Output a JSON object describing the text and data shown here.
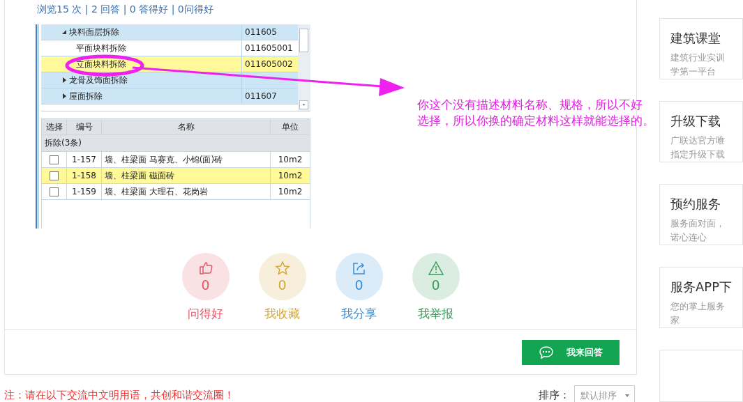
{
  "stats": "浏览15 次 | 2 回答 | 0 答得好 | 0问得好",
  "embedded_screenshot": {
    "tree": [
      {
        "label": "块料面层拆除",
        "code": "011605",
        "expanded": true,
        "selected": false,
        "children": [
          {
            "label": "平面块料拆除",
            "code": "011605001",
            "selected": false
          },
          {
            "label": "立面块料拆除",
            "code": "011605002",
            "selected": true
          }
        ]
      },
      {
        "label": "龙骨及饰面拆除",
        "expanded": false,
        "selected": false
      },
      {
        "label": "屋面拆除",
        "code": "011607",
        "expanded": false,
        "selected": false
      }
    ],
    "table": {
      "columns": [
        "选择",
        "编号",
        "名称",
        "单位"
      ],
      "group": "拆除(3条)",
      "rows": [
        {
          "checked": false,
          "selected": false,
          "code": "1-157",
          "name": "墙、柱梁面 马赛克、小锦(面)砖",
          "unit": "10m2"
        },
        {
          "checked": false,
          "selected": true,
          "code": "1-158",
          "name": "墙、柱梁面 磁面砖",
          "unit": "10m2"
        },
        {
          "checked": false,
          "selected": false,
          "code": "1-159",
          "name": "墙、柱梁面 大理石、花岗岩",
          "unit": "10m2"
        }
      ]
    }
  },
  "annotation": {
    "lines": [
      "你这个没有描述材料名称、规格，所以不好",
      "选择，所以你换的确定材料这样就能选择的。"
    ]
  },
  "actions": [
    {
      "kind": "like",
      "count": "0",
      "label": "问得好",
      "color": "#e05a6a"
    },
    {
      "kind": "favorite",
      "count": "0",
      "label": "我收藏",
      "color": "#d4a83a"
    },
    {
      "kind": "share",
      "count": "0",
      "label": "我分享",
      "color": "#3a8fd8"
    },
    {
      "kind": "report",
      "count": "0",
      "label": "我举报",
      "color": "#3a9a5a"
    }
  ],
  "answer_button": "我来回答",
  "notice": "注：请在以下交流中文明用语，共创和谐交流圈！",
  "sort": {
    "label": "排序：",
    "value": "默认排序"
  },
  "sidebar": [
    {
      "title": "建筑课堂",
      "lines": [
        "建筑行业实训",
        "学第一平台"
      ]
    },
    {
      "title": "升级下载",
      "lines": [
        "广联达官方唯",
        "指定升级下载"
      ]
    },
    {
      "title": "预约服务",
      "lines": [
        "服务面对面，",
        "诺心连心"
      ]
    },
    {
      "title": "服务APP下",
      "lines": [
        "您的掌上服务",
        "家"
      ]
    }
  ]
}
